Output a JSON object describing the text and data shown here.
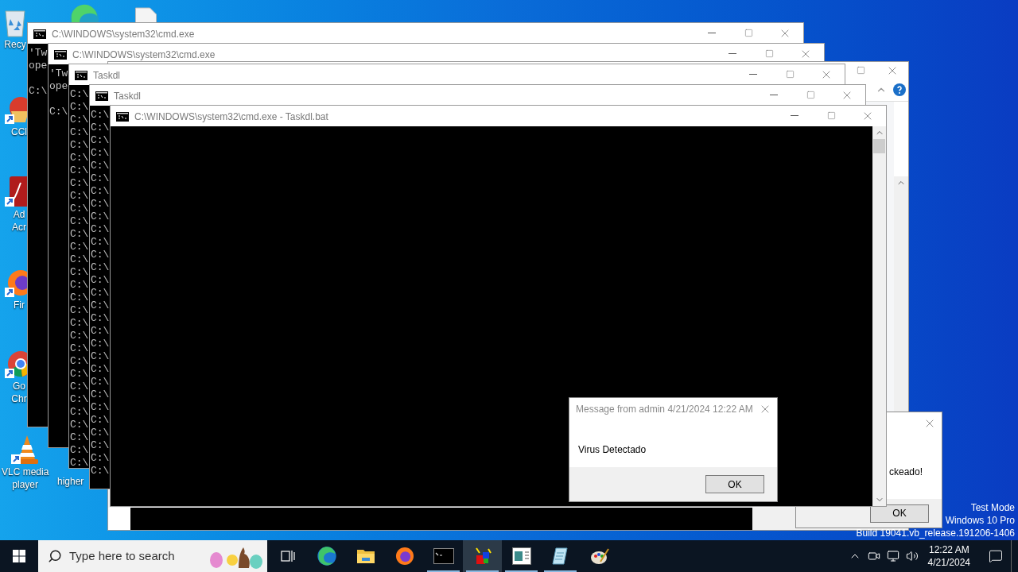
{
  "desktop_icons": [
    {
      "kind": "recycle-bin",
      "lines": [
        "Recy"
      ]
    },
    {
      "kind": "edge"
    },
    {
      "kind": "document"
    },
    {
      "kind": "ccleaner",
      "lines": [
        "CCl"
      ]
    },
    {
      "kind": "pdf",
      "lines": [
        "Ad",
        "Acr"
      ]
    },
    {
      "kind": "firefox",
      "lines": [
        "Fir"
      ]
    },
    {
      "kind": "chrome",
      "lines": [
        "Go",
        "Chr"
      ]
    },
    {
      "kind": "vlc",
      "lines": [
        "VLC media",
        "player"
      ]
    },
    {
      "kind": "label",
      "lines": [
        "higher"
      ]
    }
  ],
  "windows": [
    {
      "kind": "console",
      "title": "C:\\WINDOWS\\system32\\cmd.exe",
      "output": [
        "'Tw",
        "ope"
      ],
      "prompt": [
        "C:\\"
      ]
    },
    {
      "kind": "console",
      "title": "C:\\WINDOWS\\system32\\cmd.exe",
      "output": [
        "'Tw",
        "ope"
      ],
      "prompt": [
        "C:\\"
      ]
    },
    {
      "kind": "explorer"
    },
    {
      "kind": "console",
      "title": "Taskdl",
      "prompt": [
        "C:\\",
        "C:\\",
        "C:\\",
        "C:\\",
        "C:\\",
        "C:\\",
        "C:\\",
        "C:\\",
        "C:\\",
        "C:\\",
        "C:\\",
        "C:\\",
        "C:\\",
        "C:\\",
        "C:\\",
        "C:\\",
        "C:\\",
        "C:\\",
        "C:\\",
        "C:\\",
        "C:\\",
        "C:\\",
        "C:\\",
        "C:\\",
        "C:\\",
        "C:\\",
        "C:\\",
        "C:\\",
        "C:\\",
        "C:\\"
      ]
    },
    {
      "kind": "console",
      "title": "Taskdl",
      "prompt": [
        "C:\\",
        "C:\\",
        "C:\\",
        "C:\\",
        "C:\\",
        "C:\\",
        "C:\\",
        "C:\\",
        "C:\\",
        "C:\\",
        "C:\\",
        "C:\\",
        "C:\\",
        "C:\\",
        "C:\\",
        "C:\\",
        "C:\\",
        "C:\\",
        "C:\\",
        "C:\\",
        "C:\\",
        "C:\\",
        "C:\\",
        "C:\\",
        "C:\\",
        "C:\\",
        "C:\\",
        "C:\\",
        "C:\\"
      ]
    },
    {
      "kind": "message",
      "text": "ckeado!",
      "button": "OK"
    },
    {
      "kind": "console",
      "title": "C:\\WINDOWS\\system32\\cmd.exe - Taskdl.bat",
      "scrollbar": true
    },
    {
      "kind": "message",
      "title": "Message from admin 4/21/2024 12:22 AM",
      "text": "Virus Detectado",
      "button": "OK"
    }
  ],
  "system_notice": [
    "Test Mode",
    "Windows 10 Pro",
    "Build 19041.vb_release.191206-1406"
  ],
  "taskbar": {
    "search": {
      "placeholder": "Type here to search"
    },
    "apps": [
      {
        "kind": "task-view",
        "selected": false,
        "running": false
      },
      {
        "kind": "edge",
        "selected": false,
        "running": false
      },
      {
        "kind": "folder",
        "selected": false,
        "running": false
      },
      {
        "kind": "firefox",
        "selected": false,
        "running": false
      },
      {
        "kind": "console",
        "selected": false,
        "running": true
      },
      {
        "kind": "cubes",
        "selected": true,
        "running": true
      },
      {
        "kind": "window",
        "selected": false,
        "running": true
      },
      {
        "kind": "notepad",
        "selected": false,
        "running": true
      },
      {
        "kind": "paint",
        "selected": false,
        "running": false
      }
    ],
    "time": "12:22 AM",
    "date": "4/21/2024"
  }
}
